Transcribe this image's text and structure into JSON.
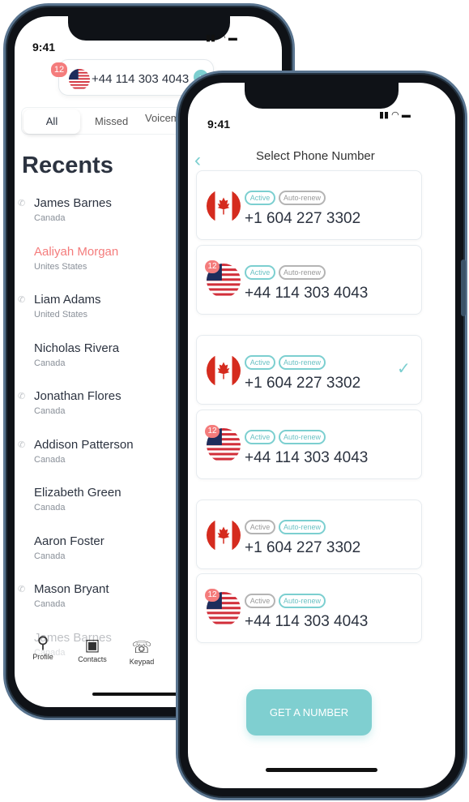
{
  "back_phone": {
    "time": "9:41",
    "selected_number": {
      "badge": "12",
      "number": "+44 114 303 4043",
      "flag": "us-flag-icon"
    },
    "tabs": [
      {
        "label": "All",
        "active": true
      },
      {
        "label": "Missed"
      },
      {
        "label": "Voicemail"
      }
    ],
    "title": "Recents",
    "recents": [
      {
        "name": "James Barnes",
        "country": "Canada",
        "icon": true
      },
      {
        "name": "Aaliyah Morgan",
        "country": "Unites States",
        "missed": true
      },
      {
        "name": "Liam Adams",
        "country": "United States",
        "icon": true
      },
      {
        "name": "Nicholas Rivera",
        "country": "Canada"
      },
      {
        "name": "Jonathan Flores",
        "country": "Canada",
        "icon": true
      },
      {
        "name": "Addison Patterson",
        "country": "Canada",
        "icon": true
      },
      {
        "name": "Elizabeth Green",
        "country": "Canada"
      },
      {
        "name": "Aaron Foster",
        "country": "Canada"
      },
      {
        "name": "Mason Bryant",
        "country": "Canada",
        "icon": true
      },
      {
        "name": "James Barnes",
        "country": "Canada"
      }
    ],
    "nav": [
      {
        "label": "Profile",
        "icon": "person-icon"
      },
      {
        "label": "Contacts",
        "icon": "contacts-icon"
      },
      {
        "label": "Keypad",
        "icon": "keypad-icon"
      }
    ],
    "colors": {
      "missed": "#f47c7c",
      "accent": "#7ccfd0"
    }
  },
  "front_phone": {
    "time": "9:41",
    "title": "Select Phone Number",
    "active_label": "Active",
    "autorenew_label": "Auto-renew",
    "numbers": [
      {
        "flag": "ca",
        "number": "+1 604 227 3302",
        "active": true,
        "autorenew": false
      },
      {
        "flag": "us",
        "badge": "12",
        "number": "+44 114 303 4043",
        "active": true,
        "autorenew": false
      },
      {
        "flag": "ca",
        "number": "+1 604 227 3302",
        "active": true,
        "autorenew": true,
        "selected": true
      },
      {
        "flag": "us",
        "badge": "12",
        "number": "+44 114 303 4043",
        "active": true,
        "autorenew": true
      },
      {
        "flag": "ca",
        "number": "+1 604 227 3302",
        "active": false,
        "autorenew": true
      },
      {
        "flag": "us",
        "badge": "12",
        "number": "+44 114 303 4043",
        "active": false,
        "autorenew": true
      }
    ],
    "cta": "GET A NUMBER",
    "colors": {
      "accent": "#7ccfd0",
      "button": "#7fcfd0"
    }
  }
}
